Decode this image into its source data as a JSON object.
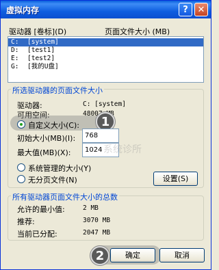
{
  "window": {
    "title": "虚拟内存",
    "help": "?",
    "close": "✕"
  },
  "header": {
    "drive_col": "驱动器 [卷标](D)",
    "pagefile_col": "页面文件大小 (MB)"
  },
  "drives": [
    {
      "drive": "C:",
      "label": "[system]",
      "selected": true
    },
    {
      "drive": "D:",
      "label": "[test1]",
      "selected": false
    },
    {
      "drive": "E:",
      "label": "[test2]",
      "selected": false
    },
    {
      "drive": "G:",
      "label": "[我的U盘]",
      "selected": false
    }
  ],
  "selected_group": {
    "title": "所选驱动器的页面文件大小",
    "drive_label": "驱动器:",
    "drive_value": "C:   [system]",
    "space_label": "可用空间:",
    "space_value": "48007 MB",
    "custom_label": "自定义大小(C):",
    "initial_label": "初始大小(MB)(I):",
    "initial_value": "768",
    "max_label": "最大值(MB)(X):",
    "max_value": "1024",
    "system_label": "系统管理的大小(Y)",
    "nopaging_label": "无分页文件(N)",
    "set_button": "设置(S)"
  },
  "total_group": {
    "title": "所有驱动器页面文件大小的总数",
    "min_label": "允许的最小值:",
    "min_value": "2 MB",
    "rec_label": "推荐:",
    "rec_value": "3070 MB",
    "cur_label": "当前已分配:",
    "cur_value": "2047 MB"
  },
  "footer": {
    "ok": "确定",
    "cancel": "取消"
  },
  "steps": [
    "1",
    "2"
  ],
  "watermark": "系统诊所",
  "colors": {
    "title_bar": "#0a5fdc",
    "selection": "#316ac5",
    "group_title": "#0046d5",
    "radio_dot": "#21a121"
  },
  "icons": {
    "help": "help-icon",
    "close": "close-icon"
  }
}
